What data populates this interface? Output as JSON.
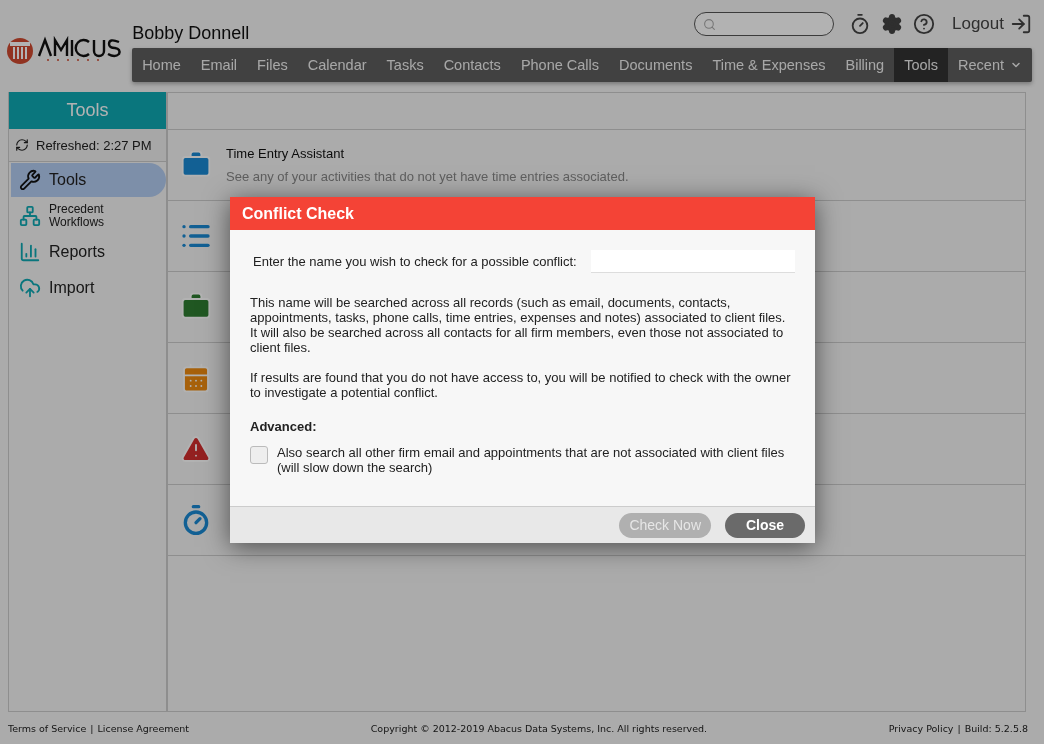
{
  "header": {
    "user_name": "Bobby Donnell",
    "logout": "Logout"
  },
  "nav": [
    {
      "label": "Home",
      "selected": false
    },
    {
      "label": "Email",
      "selected": false
    },
    {
      "label": "Files",
      "selected": false
    },
    {
      "label": "Calendar",
      "selected": false
    },
    {
      "label": "Tasks",
      "selected": false
    },
    {
      "label": "Contacts",
      "selected": false
    },
    {
      "label": "Phone Calls",
      "selected": false
    },
    {
      "label": "Documents",
      "selected": false
    },
    {
      "label": "Time & Expenses",
      "selected": false
    },
    {
      "label": "Billing",
      "selected": false
    },
    {
      "label": "Tools",
      "selected": true
    },
    {
      "label": "Recent",
      "selected": false,
      "kind": "dropdown"
    }
  ],
  "sidebar": {
    "title": "Tools",
    "refreshed": "Refreshed: 2:27 PM",
    "items": [
      {
        "label": "Tools",
        "selected": true
      },
      {
        "label": "Precedent Workflows",
        "selected": false,
        "kind": "small"
      },
      {
        "label": "Reports",
        "selected": false
      },
      {
        "label": "Import",
        "selected": false
      }
    ]
  },
  "tools": [
    {
      "title": "Time Entry Assistant",
      "description": "See any of your activities that do not yet have time entries associated."
    }
  ],
  "dialog": {
    "title": "Conflict Check",
    "prompt": "Enter the name you wish to check for a possible conflict:",
    "paragraphs": [
      "This name will be searched across all records (such as email, documents, contacts, appointments, tasks, phone calls, time entries, expenses and notes) associated to client files. It will also be searched across all contacts for all firm members, even those not associated to client files.",
      "If results are found that you do not have access to, you will be notified to check with the owner to investigate a potential conflict."
    ],
    "advanced_label": "Advanced:",
    "checkbox": {
      "label": "Also search all other firm email and appointments that are not associated with client files (will slow down the search)",
      "checked": false
    },
    "buttons": [
      {
        "label": "Check Now",
        "disabled": true
      },
      {
        "label": "Close",
        "disabled": false
      }
    ]
  },
  "footer": {
    "left": [
      "Terms of Service",
      "|",
      "License Agreement"
    ],
    "copyright": "Copyright © 2012-2019 Abacus Data Systems, Inc. All rights reserved.",
    "right": [
      "Privacy Policy",
      "|",
      "Build: 5.2.5.8"
    ]
  }
}
